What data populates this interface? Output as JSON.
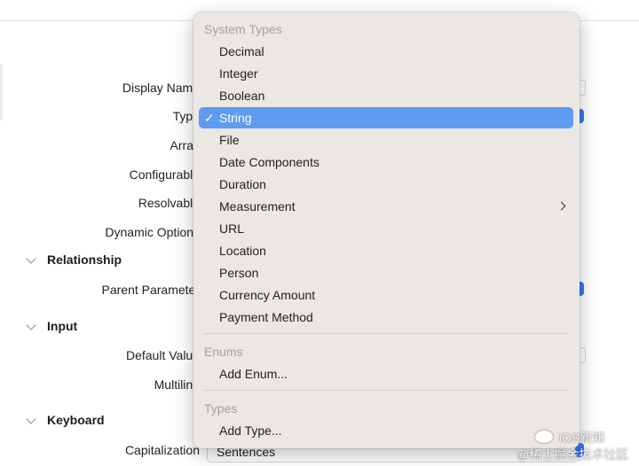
{
  "inspector": {
    "labels": {
      "display_name": "Display Name",
      "type": "Type",
      "array": "Array",
      "configurable": "Configurable",
      "resolvable": "Resolvable",
      "dynamic_options": "Dynamic Options",
      "parent_parameter": "Parent Parameter",
      "default_value": "Default Value",
      "multiline": "Multiline",
      "capitalization": "Capitalization"
    },
    "sections": {
      "relationship": "Relationship",
      "input": "Input",
      "keyboard": "Keyboard"
    },
    "capitalization_value": "Sentences"
  },
  "menu": {
    "system_types_header": "System Types",
    "system_types": [
      "Decimal",
      "Integer",
      "Boolean",
      "String",
      "File",
      "Date Components",
      "Duration",
      "Measurement",
      "URL",
      "Location",
      "Person",
      "Currency Amount",
      "Payment Method"
    ],
    "selected": "String",
    "check_glyph": "✓",
    "enums_header": "Enums",
    "add_enum": "Add Enum...",
    "types_header": "Types",
    "add_type": "Add Type..."
  },
  "watermark": {
    "line1": "iOS新知",
    "line2": "@稀土掘金技术社区"
  },
  "colors": {
    "selection": "#5f9bf1",
    "menu_background": "#ebe7e2",
    "accent": "#3478f6"
  }
}
